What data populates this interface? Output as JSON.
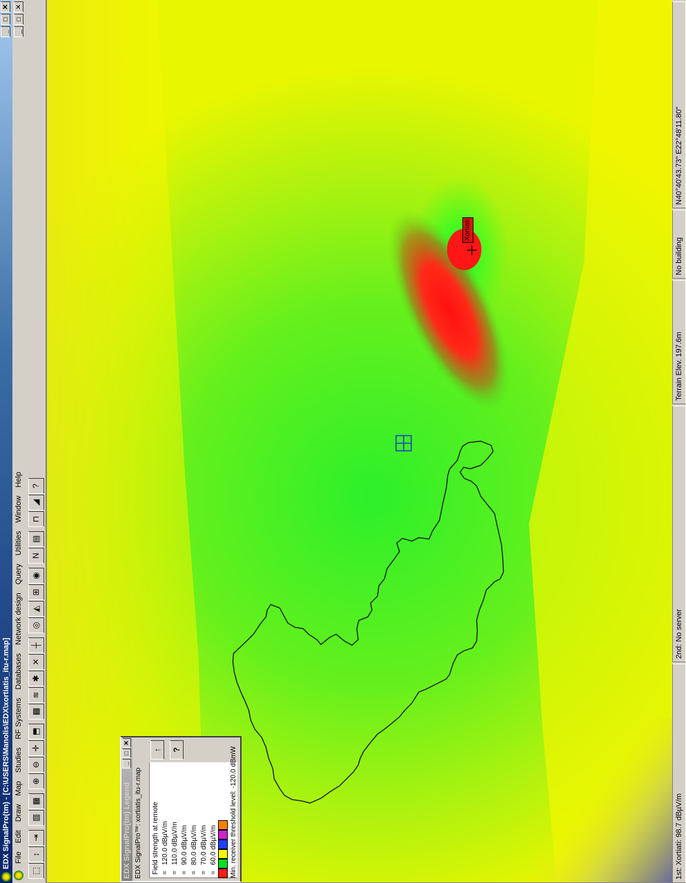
{
  "window": {
    "title": "EDX SignalPro(tm) - [C:\\USERS\\Manolis\\EDX\\xortiatis_itu-r.map]",
    "controls": [
      "_",
      "□",
      "✕"
    ]
  },
  "menu": {
    "items": [
      "File",
      "Edit",
      "Draw",
      "Map",
      "Studies",
      "RF Systems",
      "Databases",
      "Network design",
      "Query",
      "Utilities",
      "Window",
      "Help"
    ],
    "mdi_controls": [
      "_",
      "□",
      "✕"
    ]
  },
  "toolbar": {
    "buttons": [
      {
        "name": "select-tool",
        "glyph": "⬚"
      },
      {
        "name": "pan-tool",
        "glyph": "↕"
      },
      {
        "name": "move-tool",
        "glyph": "⇥"
      },
      {
        "name": "map-layers",
        "glyph": "▥"
      },
      {
        "name": "open-map",
        "glyph": "▦"
      },
      {
        "name": "zoom-in",
        "glyph": "⊕"
      },
      {
        "name": "zoom-out",
        "glyph": "⊖"
      },
      {
        "name": "crosshair",
        "glyph": "✛"
      },
      {
        "name": "edit-object",
        "glyph": "⬒"
      },
      {
        "name": "coverage-study",
        "glyph": "▩"
      },
      {
        "name": "layers-stack",
        "glyph": "≋"
      },
      {
        "name": "asterisk",
        "glyph": "✱"
      },
      {
        "name": "cross-lines",
        "glyph": "✕"
      },
      {
        "name": "ruler",
        "glyph": "┼"
      },
      {
        "name": "target",
        "glyph": "◎"
      },
      {
        "name": "profile",
        "glyph": "◭"
      },
      {
        "name": "network",
        "glyph": "⊞"
      },
      {
        "name": "site",
        "glyph": "◉"
      },
      {
        "name": "new-link",
        "glyph": "N"
      },
      {
        "name": "print",
        "glyph": "▤"
      },
      {
        "name": "antenna",
        "glyph": "⊓"
      },
      {
        "name": "eraser",
        "glyph": "◢"
      },
      {
        "name": "help",
        "glyph": "?"
      }
    ]
  },
  "map": {
    "transmitter_label": "Xortiati",
    "colors": {
      "red": "#ff1a1a",
      "green": "#3cf01e",
      "yellow": "#f2f600",
      "lightgreen": "#9ef21a",
      "blue": "#6a6a9a"
    }
  },
  "legend": {
    "title": "EDX SignalPro(tm) Legend",
    "subtitle": "EDX SignalPro™: xortiatis_itu-r.map",
    "heading": "Field strength at remote",
    "entries": [
      {
        "label": "120.0 dBµV/m",
        "color": "#ff1a1a"
      },
      {
        "label": "110.0 dBµV/m",
        "color": "#00e020"
      },
      {
        "label": "90.0 dBµV/m",
        "color": "#f2f600"
      },
      {
        "label": "80.0 dBµV/m",
        "color": "#2040ff"
      },
      {
        "label": "70.0 dBµV/m",
        "color": "#d020d0"
      },
      {
        "label": "60.0 dBµV/m",
        "color": "#ff8000"
      }
    ],
    "eq": "=",
    "up_button": "↑",
    "help_button": "?",
    "threshold": "Min. receiver threshold level: -120.0 dBmW"
  },
  "status": {
    "first": "1st: Xortiati: 98.7 dBµV/m",
    "second": "2nd: No server",
    "elev": "Terrain Elev. 197.6m",
    "building": "No building",
    "coords": "N40°40'43.73\" E22°48'11.80\""
  }
}
